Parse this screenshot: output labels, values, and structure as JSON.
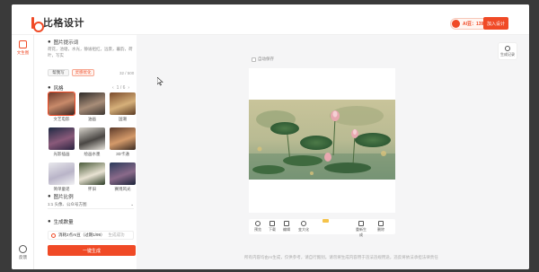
{
  "header": {
    "logo_text": "比格设计",
    "ai_points": "AI豆：139",
    "join_label": "加入设计"
  },
  "rail": {
    "items": [
      {
        "label": "文生图",
        "icon": "image-chat-icon"
      },
      {
        "label": "反馈",
        "icon": "chat-icon"
      }
    ]
  },
  "panel": {
    "prompt_title": "图片提示词",
    "prompt_text": "荷花，池塘，水光，静谧祖红，远景，暮韵，荷叶，写实",
    "chip_example": "帮我写",
    "chip_optimize": "灵感优化",
    "char_count": "32 / 500",
    "style_title": "风格",
    "style_pager": "1 / 6",
    "styles": [
      {
        "label": "文艺电影",
        "selected": true
      },
      {
        "label": "油画",
        "selected": false
      },
      {
        "label": "国潮",
        "selected": false
      },
      {
        "label": "光影插画",
        "selected": false
      },
      {
        "label": "绘画水墨",
        "selected": false
      },
      {
        "label": "3D卡通",
        "selected": false
      },
      {
        "label": "简单童谣",
        "selected": false
      },
      {
        "label": "怀旧",
        "selected": false
      },
      {
        "label": "赛博风光",
        "selected": false
      }
    ],
    "ratio_title": "图片比例",
    "ratio_value": "1:1 头像、公众号方图",
    "count_title": "生成数量",
    "gen_option": "消耗2点AI豆（过期1/99）",
    "gen_hint": "生成成功",
    "generate_button": "一键生成"
  },
  "canvas": {
    "auto_check": "自动保存",
    "history_label": "生成记录",
    "toolbar": [
      {
        "label": "预览",
        "icon": "eye-icon"
      },
      {
        "label": "下载",
        "icon": "download-icon"
      },
      {
        "label": "编辑",
        "icon": "edit-icon"
      },
      {
        "label": "变大化",
        "icon": "zoom-icon"
      },
      {
        "label": "重新生成",
        "icon": "regenerate-icon"
      },
      {
        "label": "删除",
        "icon": "trash-icon"
      }
    ],
    "disclaimer": "所有内容均由AI生成，仅供参考，请自行甄别。请勿将生成内容用于违法违规用途，违反将依法承担法律责任"
  },
  "colors": {
    "accent": "#f04a26",
    "canvas_bg": "#f5f5f6"
  }
}
